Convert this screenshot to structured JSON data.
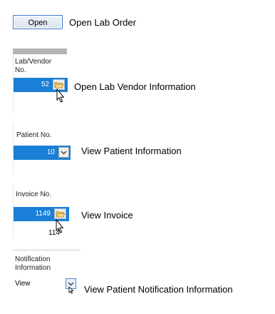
{
  "open_order": {
    "button_label": "Open",
    "description": "Open Lab Order"
  },
  "lab_vendor": {
    "header": "Lab/Vendor\nNo.",
    "value": "52",
    "description": "Open Lab Vendor Information"
  },
  "patient": {
    "header": "Patient No.",
    "value": "10",
    "description": "View Patient Information"
  },
  "invoice": {
    "header": "Invoice No.",
    "value": "1149",
    "next_value": "114",
    "description": "View Invoice"
  },
  "notification": {
    "header": "Notification\nInformation",
    "value": "View",
    "description": "View Patient Notification Information"
  },
  "colors": {
    "selection_blue": "#1a7fd6",
    "button_border": "#3f7ac9",
    "folder_icon": "#e8b84a"
  },
  "icons": [
    "folder-icon",
    "chevron-down-icon",
    "mouse-pointer-icon"
  ]
}
